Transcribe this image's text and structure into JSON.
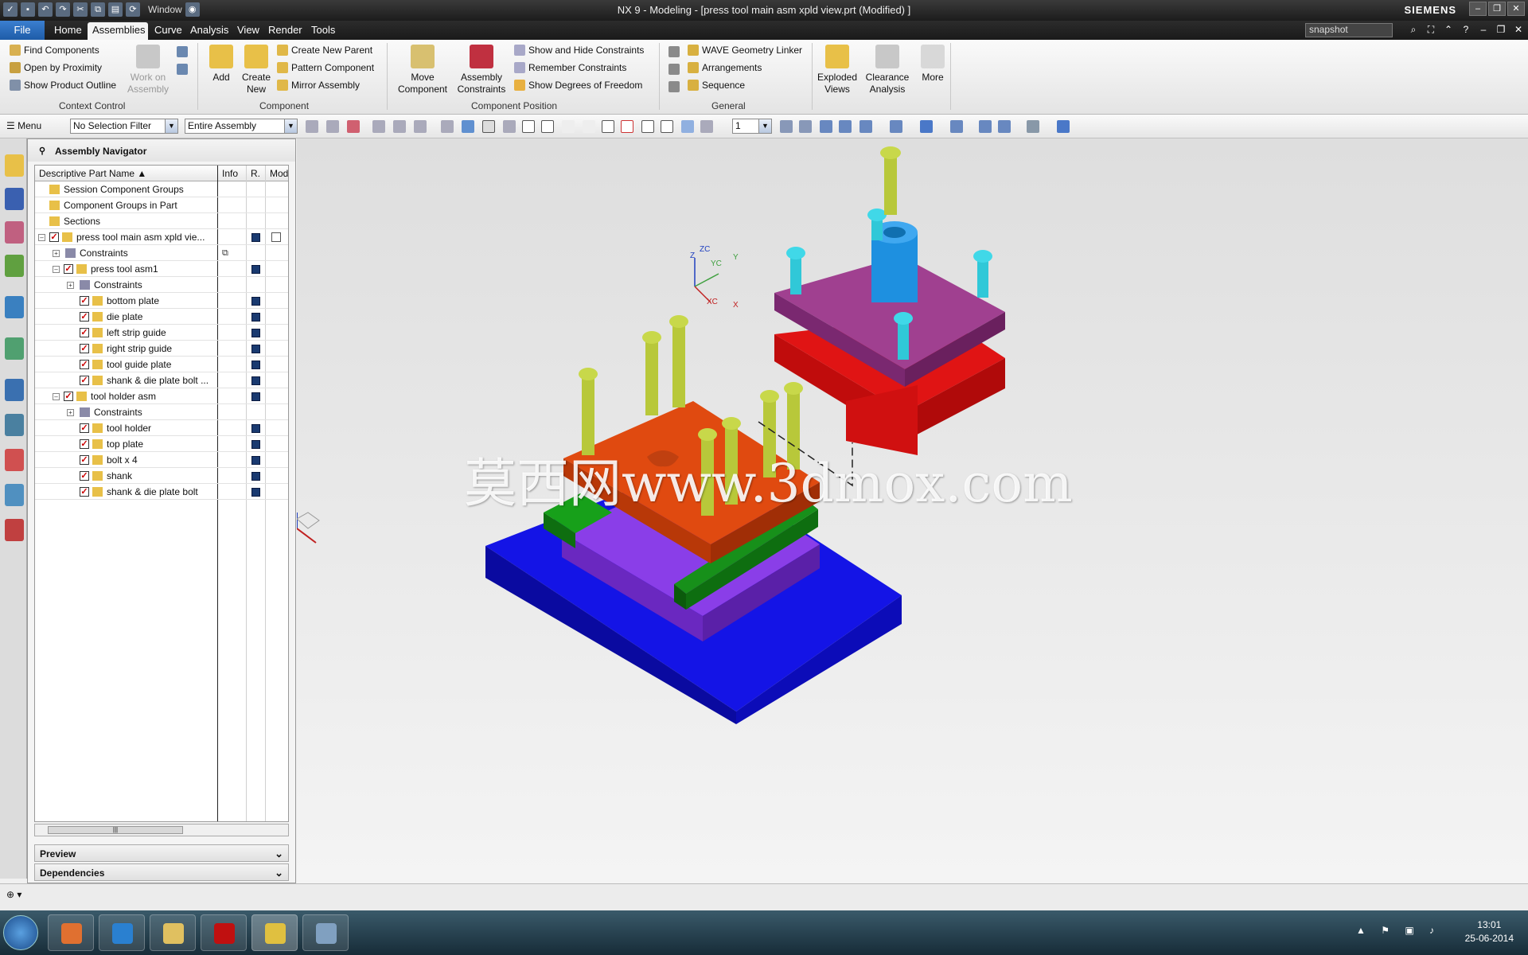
{
  "window": {
    "title": "NX 9 - Modeling - [press tool main asm xpld view.prt (Modified) ]",
    "brand": "SIEMENS",
    "quick_access_window": "Window"
  },
  "menubar": {
    "file": "File",
    "tabs": [
      "Home",
      "Assemblies",
      "Curve",
      "Analysis",
      "View",
      "Render",
      "Tools"
    ],
    "active_tab": "Assemblies",
    "search_value": "snapshot"
  },
  "ribbon": {
    "context_control": {
      "items": [
        "Find Components",
        "Open by Proximity",
        "Show Product Outline"
      ],
      "work_on_assembly": "Work on Assembly",
      "group_label": "Context Control"
    },
    "component": {
      "add": "Add",
      "create_new": "Create New",
      "items": [
        "Create New Parent",
        "Pattern Component",
        "Mirror Assembly"
      ],
      "group_label": "Component"
    },
    "component_position": {
      "move_component": "Move Component",
      "assembly_constraints": "Assembly Constraints",
      "items": [
        "Show and Hide Constraints",
        "Remember Constraints",
        "Show Degrees of Freedom"
      ],
      "group_label": "Component Position"
    },
    "general": {
      "items": [
        "WAVE Geometry Linker",
        "Arrangements",
        "Sequence"
      ],
      "group_label": "General"
    },
    "exploded_views": "Exploded Views",
    "clearance_analysis": "Clearance Analysis",
    "more": "More"
  },
  "toolbar": {
    "menu": "Menu",
    "selection_filter": "No Selection Filter",
    "scope": "Entire Assembly",
    "layer": "1"
  },
  "navigator": {
    "title": "Assembly Navigator",
    "columns": [
      "Descriptive Part Name",
      "Info",
      "R.",
      "Mod"
    ],
    "rows": [
      {
        "label": "Session Component Groups"
      },
      {
        "label": "Component Groups in Part"
      },
      {
        "label": "Sections"
      },
      {
        "label": "press tool main asm xpld vie..."
      },
      {
        "label": "Constraints"
      },
      {
        "label": "press tool asm1"
      },
      {
        "label": "Constraints"
      },
      {
        "label": "bottom plate"
      },
      {
        "label": "die plate"
      },
      {
        "label": "left strip guide"
      },
      {
        "label": "right strip guide"
      },
      {
        "label": "tool guide plate"
      },
      {
        "label": "shank & die plate bolt ..."
      },
      {
        "label": "tool holder asm"
      },
      {
        "label": "Constraints"
      },
      {
        "label": "tool holder"
      },
      {
        "label": "top plate"
      },
      {
        "label": "bolt x 4"
      },
      {
        "label": "shank"
      },
      {
        "label": "shank & die plate bolt"
      }
    ],
    "panes": [
      "Preview",
      "Dependencies"
    ]
  },
  "viewport": {
    "watermark": "莫西网www.3dmox.com",
    "csys_labels": [
      "Z",
      "ZC",
      "YC",
      "Y",
      "XC",
      "X"
    ]
  },
  "taskbar": {
    "time": "13:01",
    "date": "25-06-2014"
  },
  "colors": {
    "bottom_plate": "#1414e6",
    "die_plate": "#8a3ee8",
    "strip_guides": "#17901a",
    "tool_guide_plate": "#e04a10",
    "tool_holder": "#e01414",
    "top_plate": "#a04090",
    "shank": "#1e90e0",
    "bolts": "#b8c83a",
    "bolt_heads": "#30c8d8"
  }
}
